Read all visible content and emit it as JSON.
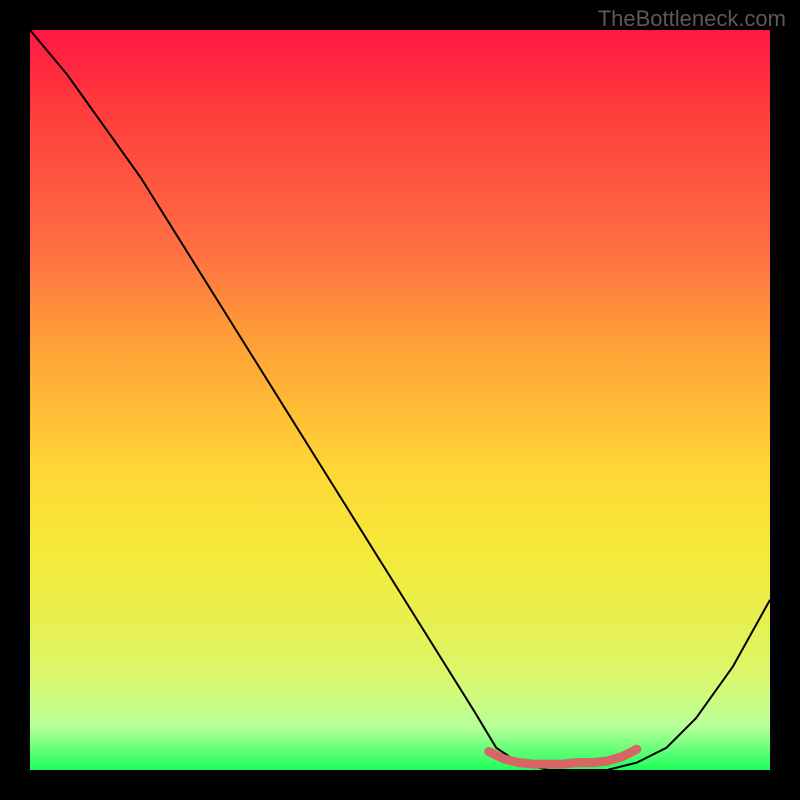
{
  "watermark": "TheBottleneck.com",
  "chart_data": {
    "type": "line",
    "title": "",
    "xlabel": "",
    "ylabel": "",
    "xlim": [
      0,
      100
    ],
    "ylim": [
      0,
      100
    ],
    "series": [
      {
        "name": "bottleneck-curve",
        "color": "#000000",
        "x": [
          0,
          5,
          10,
          15,
          20,
          25,
          30,
          35,
          40,
          45,
          50,
          55,
          60,
          63,
          66,
          70,
          74,
          78,
          82,
          86,
          90,
          95,
          100
        ],
        "y": [
          100,
          94,
          87,
          80,
          72,
          64,
          56,
          48,
          40,
          32,
          24,
          16,
          8,
          3,
          1,
          0,
          0,
          0,
          1,
          3,
          7,
          14,
          23
        ]
      },
      {
        "name": "optimal-region-marker",
        "color": "#e06060",
        "x": [
          62,
          64,
          66,
          68,
          70,
          72,
          74,
          76,
          78,
          80,
          82
        ],
        "y": [
          2.5,
          1.5,
          1,
          0.8,
          0.8,
          0.8,
          1,
          1,
          1.2,
          1.8,
          2.8
        ]
      }
    ],
    "background_gradient": {
      "top": "#ff1744",
      "middle": "#ffd835",
      "bottom": "#1dff5a"
    }
  }
}
